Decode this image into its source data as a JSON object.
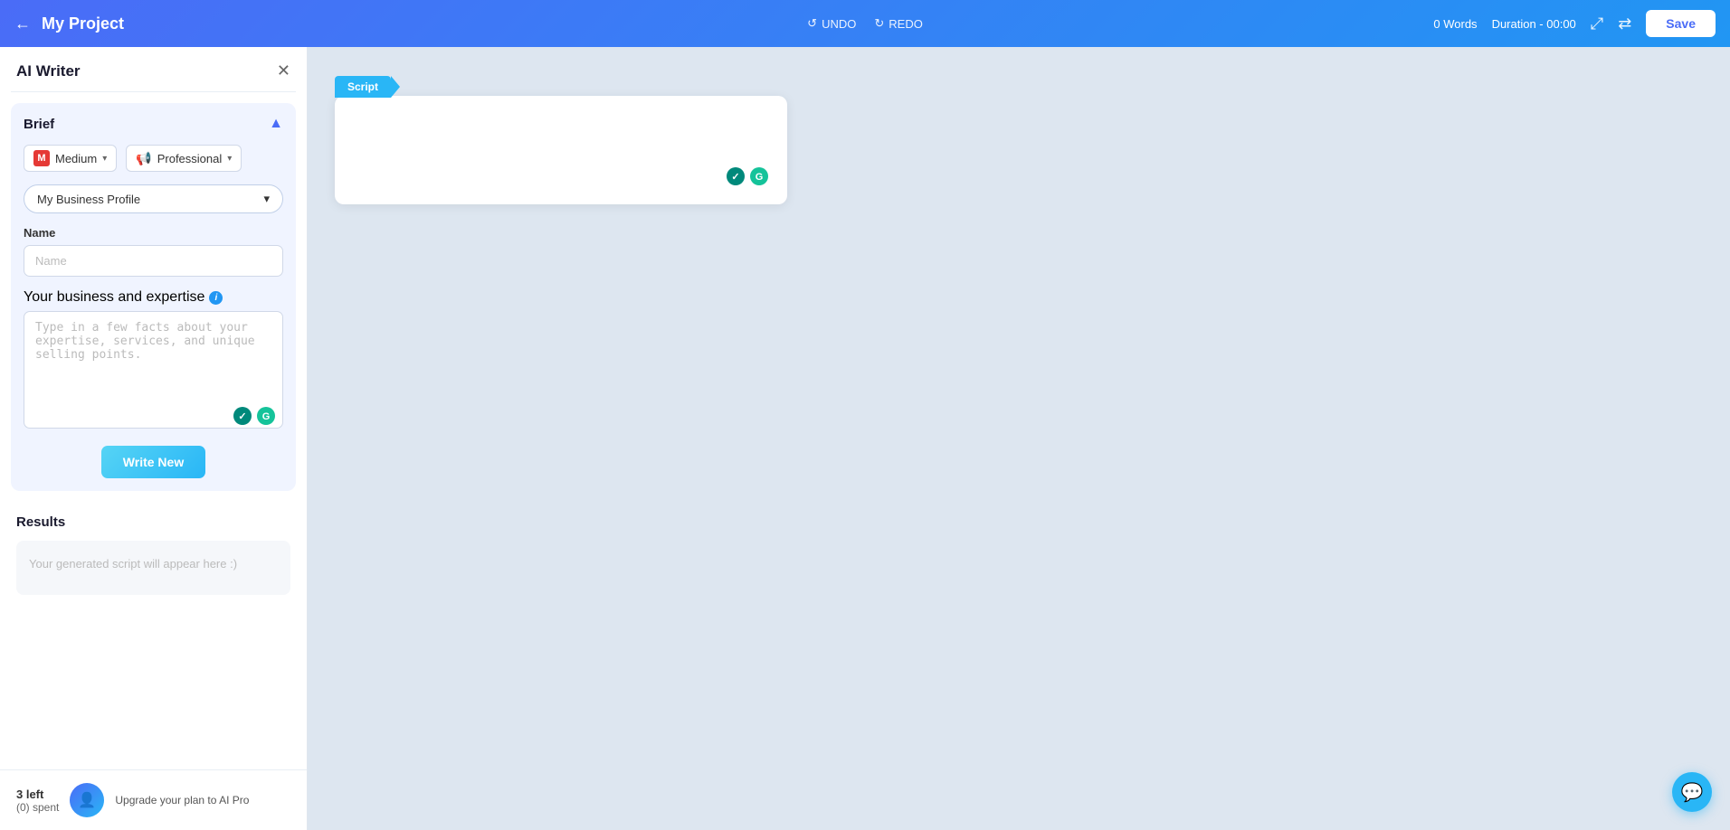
{
  "header": {
    "back_label": "←",
    "title": "My Project",
    "undo_label": "UNDO",
    "redo_label": "REDO",
    "word_count": "0 Words",
    "duration": "Duration - 00:00",
    "save_label": "Save"
  },
  "sidebar": {
    "title": "AI Writer",
    "brief": {
      "title": "Brief",
      "medium": {
        "icon": "M",
        "label": "Medium",
        "chevron": "▾"
      },
      "professional": {
        "icon": "📢",
        "label": "Professional",
        "chevron": "▾"
      },
      "profile_dropdown": {
        "label": "My Business Profile",
        "chevron": "▾"
      },
      "name_field": {
        "label": "Name",
        "placeholder": "Name"
      },
      "expertise_field": {
        "label": "Your business and expertise",
        "placeholder": "Type in a few facts about your expertise, services, and unique selling points."
      },
      "write_new_label": "Write New"
    },
    "results": {
      "title": "Results",
      "placeholder": "Your generated script will appear here :)"
    },
    "upgrade": {
      "count_label": "3 left",
      "spent_label": "(0) spent",
      "upgrade_text": "Upgrade your plan to AI Pro"
    }
  },
  "script_tag_label": "Script",
  "chat_icon": "💬",
  "icons": {
    "grammarly": "G",
    "spell_check": "✓"
  }
}
